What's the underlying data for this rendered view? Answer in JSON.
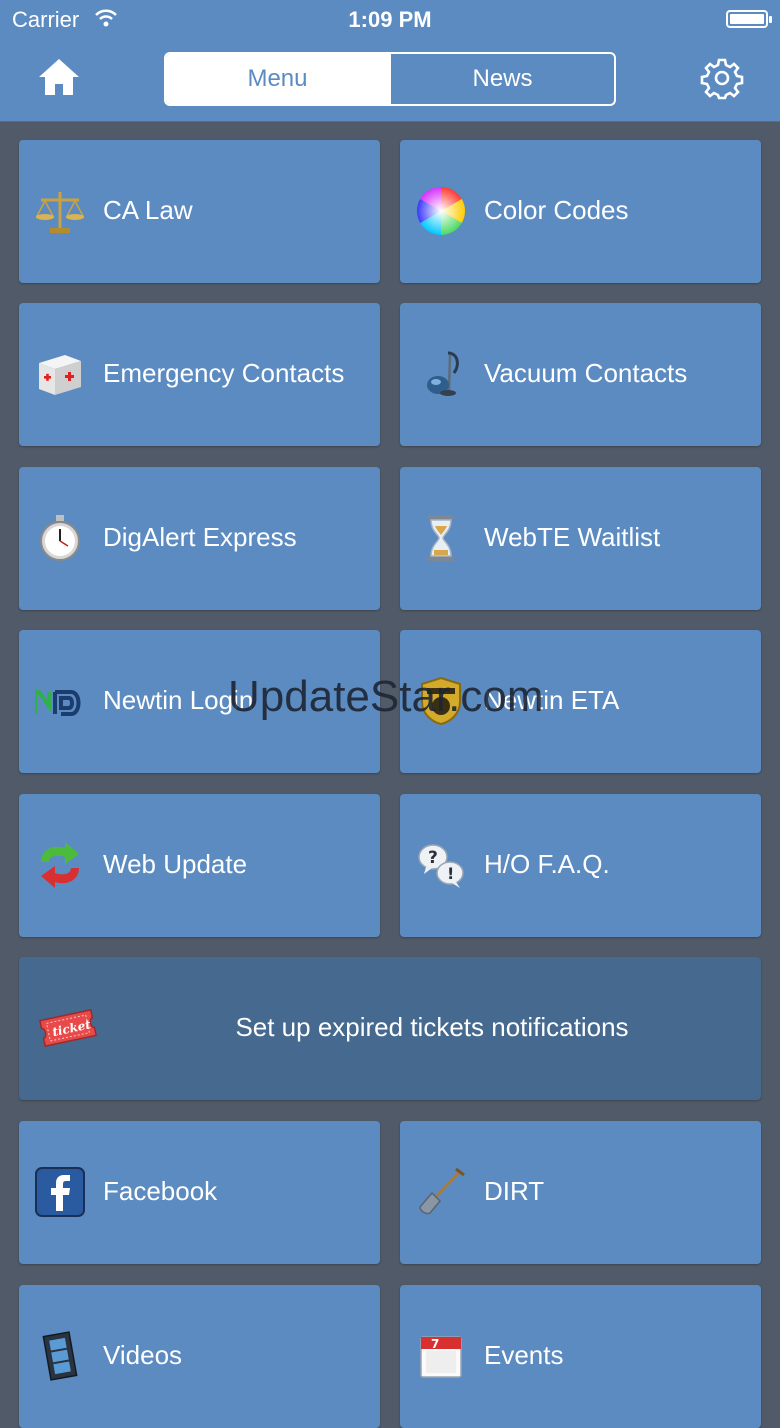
{
  "status_bar": {
    "carrier": "Carrier",
    "time": "1:09 PM"
  },
  "nav": {
    "tabs": [
      {
        "label": "Menu",
        "active": true
      },
      {
        "label": "News",
        "active": false
      }
    ],
    "home_icon": "home-icon",
    "settings_icon": "gear-icon"
  },
  "tiles": [
    {
      "label": "CA Law",
      "icon": "scales-icon"
    },
    {
      "label": "Color Codes",
      "icon": "color-wheel-icon"
    },
    {
      "label": "Emergency Contacts",
      "icon": "first-aid-icon"
    },
    {
      "label": "Vacuum Contacts",
      "icon": "vacuum-icon"
    },
    {
      "label": "DigAlert Express",
      "icon": "stopwatch-icon"
    },
    {
      "label": "WebTE Waitlist",
      "icon": "hourglass-icon"
    },
    {
      "label": "Newtin Login",
      "icon": "newtin-logo-icon"
    },
    {
      "label": "Newtin ETA",
      "icon": "badge-icon"
    },
    {
      "label": "Web Update",
      "icon": "refresh-arrows-icon"
    },
    {
      "label": "H/O F.A.Q.",
      "icon": "question-bubbles-icon"
    },
    {
      "label": "Set up expired tickets notifications",
      "icon": "ticket-icon"
    },
    {
      "label": "Facebook",
      "icon": "facebook-icon"
    },
    {
      "label": "DIRT",
      "icon": "shovel-icon"
    },
    {
      "label": "Videos",
      "icon": "film-icon"
    },
    {
      "label": "Events",
      "icon": "calendar-icon"
    }
  ],
  "calendar_day": "7",
  "watermark": "UpdateStar.com",
  "colors": {
    "background": "#515a68",
    "tile": "#5b8bc1",
    "tile_wide": "#46698f",
    "nav": "#5b8bc1"
  }
}
